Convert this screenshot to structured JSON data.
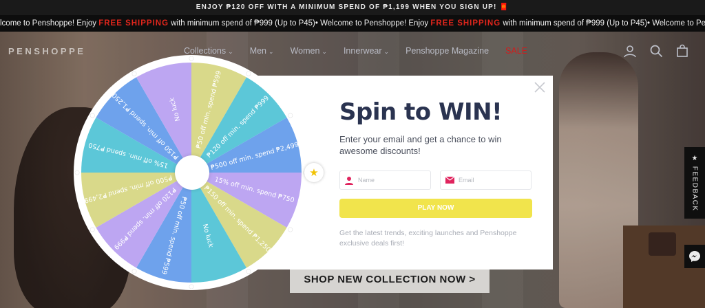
{
  "announcement": "ENJOY ₱120 OFF WITH A MINIMUM SPEND OF ₱1,199 WHEN YOU SIGN UP! 🧧",
  "marquee": {
    "part1": "lcome to Penshoppe! Enjoy ",
    "highlight": "FREE SHIPPING",
    "part2": " with minimum spend of ₱999 (Up to P45)• Welcome to Penshoppe! Enjoy ",
    "highlight2": "FREE SHIPPING",
    "part3": " with minimum spend of ₱999 (Up to P45)• Welcome to Penshoppe! Enjoy "
  },
  "nav": {
    "logo": "PENSHOPPE",
    "items": [
      {
        "label": "Collections",
        "dropdown": true
      },
      {
        "label": "Men",
        "dropdown": true
      },
      {
        "label": "Women",
        "dropdown": true
      },
      {
        "label": "Innerwear",
        "dropdown": true
      },
      {
        "label": "Penshoppe Magazine",
        "dropdown": false
      },
      {
        "label": "SALE",
        "dropdown": false
      }
    ],
    "icons": [
      "account-icon",
      "search-icon",
      "bag-icon"
    ]
  },
  "hero": {
    "cta": "SHOP NEW COLLECTION NOW >"
  },
  "feedback": "★ FEEDBACK",
  "popup": {
    "title": "Spin to WIN!",
    "subtitle": "Enter your email and get a chance to win awesome discounts!",
    "name_placeholder": "Name",
    "email_placeholder": "Email",
    "play_label": "PLAY NOW",
    "disclaimer": "Get the latest trends, exciting launches and Penshoppe exclusive deals first!"
  },
  "wheel": {
    "colors": {
      "yellow": "#d9d98a",
      "teal": "#5cc7d8",
      "blue": "#6ea2ec",
      "lilac": "#bda6f2"
    },
    "segments": [
      {
        "label": "₱50 off min. spend ₱599",
        "color": "yellow"
      },
      {
        "label": "₱120 off min. spend ₱999",
        "color": "teal"
      },
      {
        "label": "₱500 off min. spend ₱2,499",
        "color": "blue"
      },
      {
        "label": "15% off min. spend ₱750",
        "color": "lilac"
      },
      {
        "label": "₱150 off min. spend ₱1,250",
        "color": "yellow"
      },
      {
        "label": "No luck",
        "color": "teal"
      },
      {
        "label": "₱50 off min. spend ₱599",
        "color": "blue"
      },
      {
        "label": "₱120 off min. spend ₱999",
        "color": "lilac"
      },
      {
        "label": "₱500 off min. spend ₱2,499",
        "color": "yellow"
      },
      {
        "label": "15% off min. spend ₱750",
        "color": "teal"
      },
      {
        "label": "₱150 off min. spend ₱1,250",
        "color": "blue"
      },
      {
        "label": "No luck",
        "color": "lilac"
      }
    ]
  },
  "colors": {
    "title": "#2a3350",
    "play_button": "#f1e44c",
    "sale": "#e02020",
    "icon_red": "#e0245e"
  }
}
